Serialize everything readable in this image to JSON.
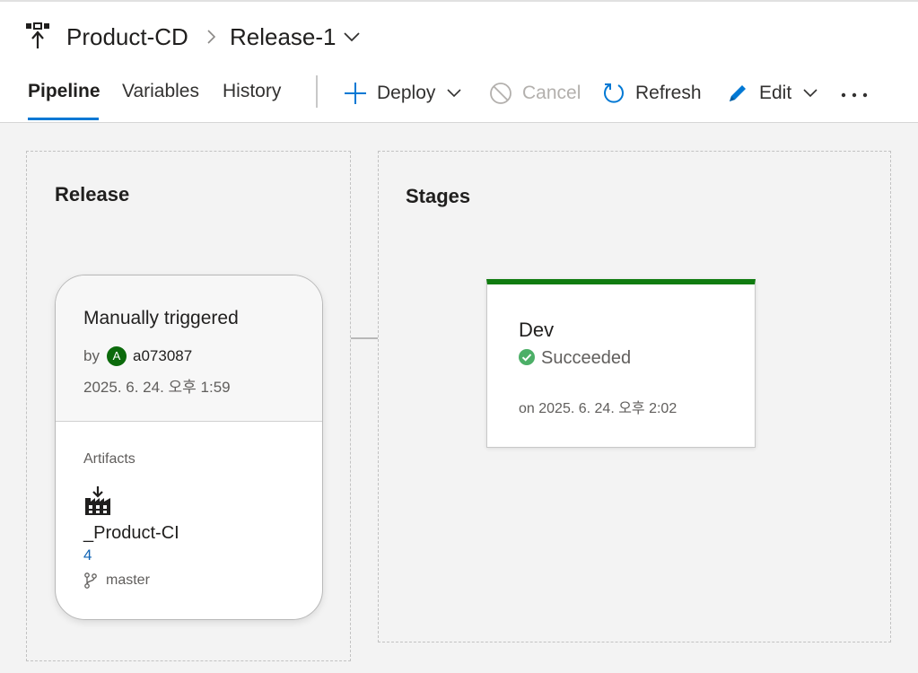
{
  "breadcrumb": {
    "pipeline_icon": "release-pipeline-icon",
    "pipeline": "Product-CD",
    "separator_icon": "chevron-right-icon",
    "release": "Release-1",
    "release_menu_icon": "chevron-down-icon"
  },
  "tabs": [
    {
      "label": "Pipeline",
      "active": true
    },
    {
      "label": "Variables",
      "active": false
    },
    {
      "label": "History",
      "active": false
    }
  ],
  "toolbar": {
    "deploy": {
      "label": "Deploy",
      "icon": "plus-icon"
    },
    "cancel": {
      "label": "Cancel",
      "icon": "cancel-icon",
      "disabled": true
    },
    "refresh": {
      "label": "Refresh",
      "icon": "refresh-icon"
    },
    "edit": {
      "label": "Edit",
      "icon": "pencil-icon"
    },
    "more_icon": "more-icon"
  },
  "release_panel": {
    "title": "Release",
    "trigger": "Manually triggered",
    "by_label": "by",
    "user_initial": "A",
    "user": "a073087",
    "date": "2025. 6. 24. 오후 1:59",
    "artifacts_label": "Artifacts",
    "artifact": {
      "icon": "build-artifact-icon",
      "name": "_Product-CI",
      "version": "4",
      "branch_icon": "branch-icon",
      "branch": "master"
    }
  },
  "stages_panel": {
    "title": "Stages",
    "stage": {
      "name": "Dev",
      "status": "Succeeded",
      "status_icon": "success-check-icon",
      "date": "on 2025. 6. 24. 오후 2:02"
    }
  },
  "colors": {
    "accent": "#0078d4",
    "success": "#107c10",
    "success_icon": "#4caf67",
    "link": "#0f63b4",
    "avatar": "#0b6a0b"
  }
}
